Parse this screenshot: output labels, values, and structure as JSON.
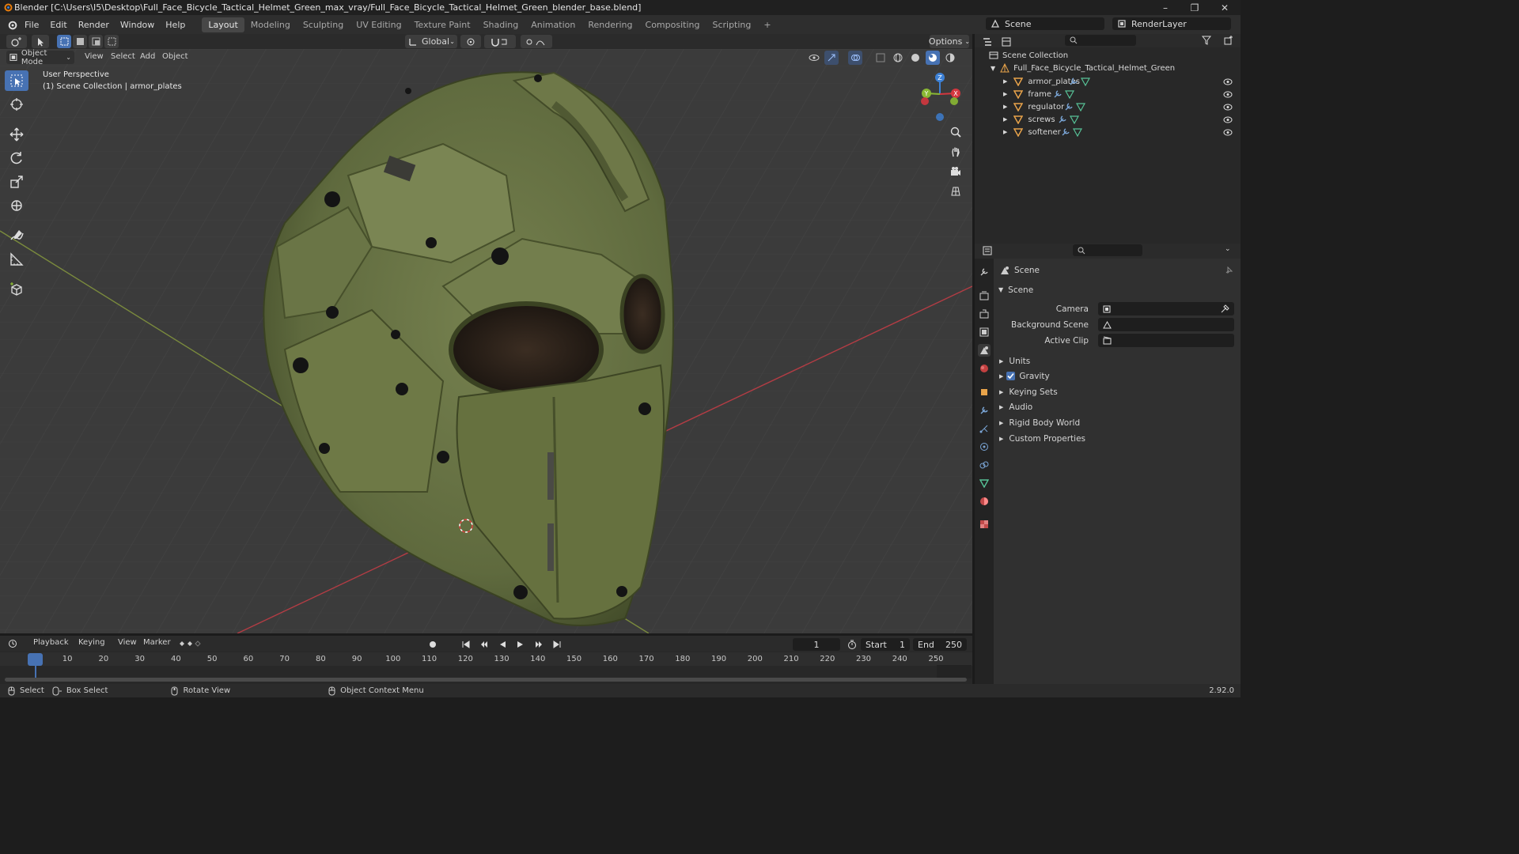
{
  "window": {
    "title": "Blender [C:\\Users\\I5\\Desktop\\Full_Face_Bicycle_Tactical_Helmet_Green_max_vray/Full_Face_Bicycle_Tactical_Helmet_Green_blender_base.blend]",
    "minimize": "–",
    "maximize": "❐",
    "close": "✕"
  },
  "menubar": {
    "items": [
      "File",
      "Edit",
      "Render",
      "Window",
      "Help"
    ],
    "workspaces": [
      "Layout",
      "Modeling",
      "Sculpting",
      "UV Editing",
      "Texture Paint",
      "Shading",
      "Animation",
      "Rendering",
      "Compositing",
      "Scripting"
    ],
    "active_workspace": "Layout",
    "add_tab": "+",
    "scene_name": "Scene",
    "view_layer": "RenderLayer"
  },
  "viewport_header": {
    "transform_orientation": "Global",
    "options_label": "Options",
    "mode": "Object Mode",
    "menus": [
      "View",
      "Select",
      "Add",
      "Object"
    ]
  },
  "viewport": {
    "overlay_line1": "User Perspective",
    "overlay_line2": "(1) Scene Collection | armor_plates",
    "gizmo": {
      "x": "X",
      "y": "Y",
      "z": "Z"
    }
  },
  "outliner": {
    "root": "Scene Collection",
    "collection": "Full_Face_Bicycle_Tactical_Helmet_Green",
    "objects": [
      "armor_plates",
      "frame",
      "regulator",
      "screws",
      "softener"
    ]
  },
  "properties": {
    "context": "Scene",
    "panel_title": "Scene",
    "fields": [
      {
        "label": "Camera",
        "value": ""
      },
      {
        "label": "Background Scene",
        "value": ""
      },
      {
        "label": "Active Clip",
        "value": ""
      }
    ],
    "sections": [
      "Units",
      "Gravity",
      "Keying Sets",
      "Audio",
      "Rigid Body World",
      "Custom Properties"
    ],
    "gravity_checked": true
  },
  "timeline": {
    "menus": [
      "Playback",
      "Keying",
      "View",
      "Marker"
    ],
    "current_frame": "1",
    "start_label": "Start",
    "start": "1",
    "end_label": "End",
    "end": "250",
    "ticks": [
      "1",
      "10",
      "20",
      "30",
      "40",
      "50",
      "60",
      "70",
      "80",
      "90",
      "100",
      "110",
      "120",
      "130",
      "140",
      "150",
      "160",
      "170",
      "180",
      "190",
      "200",
      "210",
      "220",
      "230",
      "240",
      "250"
    ]
  },
  "statusbar": {
    "select": "Select",
    "box_select": "Box Select",
    "rotate": "Rotate View",
    "context_menu": "Object Context Menu",
    "version": "2.92.0"
  },
  "colors": {
    "accent": "#4772b3",
    "helmet": "#6b7548",
    "x_axis": "#d4373f",
    "y_axis": "#8ab833",
    "z_axis": "#3d81d6"
  }
}
